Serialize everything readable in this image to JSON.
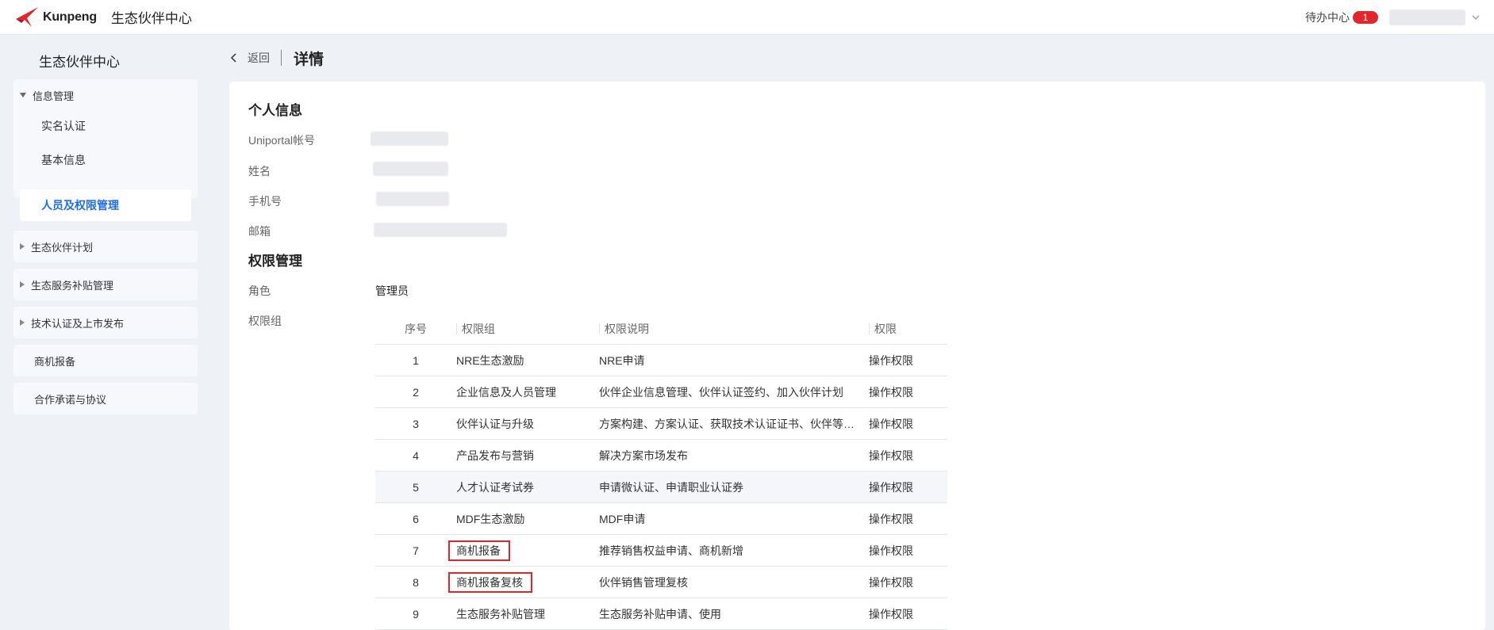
{
  "header": {
    "logo_text": "Kunpeng",
    "app_title": "生态伙伴中心",
    "todo_label": "待办中心",
    "todo_count": "1",
    "brand_red": "#e3262b"
  },
  "sidebar": {
    "title": "生态伙伴中心",
    "groups": [
      {
        "label": "信息管理",
        "expanded": true,
        "items": [
          {
            "label": "实名认证"
          },
          {
            "label": "基本信息"
          },
          {
            "label": "人员及权限管理",
            "active": true
          }
        ]
      },
      {
        "label": "生态伙伴计划",
        "expanded": false
      },
      {
        "label": "生态服务补贴管理",
        "expanded": false
      },
      {
        "label": "技术认证及上市发布",
        "expanded": false
      },
      {
        "label": "商机报备"
      },
      {
        "label": "合作承诺与协议"
      }
    ],
    "active_color": "#1f6de8"
  },
  "page": {
    "back_label": "返回",
    "title": "详情"
  },
  "personal": {
    "section_title": "个人信息",
    "fields": [
      {
        "label": "Uniportal帐号"
      },
      {
        "label": "姓名"
      },
      {
        "label": "手机号"
      },
      {
        "label": "邮箱"
      }
    ]
  },
  "permissions": {
    "section_title": "权限管理",
    "role_label": "角色",
    "role_value": "管理员",
    "group_label": "权限组",
    "table": {
      "headers": [
        "序号",
        "权限组",
        "权限说明",
        "权限"
      ],
      "rows": [
        {
          "no": "1",
          "group": "NRE生态激励",
          "desc": "NRE申请",
          "perm": "操作权限"
        },
        {
          "no": "2",
          "group": "企业信息及人员管理",
          "desc": "伙伴企业信息管理、伙伴认证签约、加入伙伴计划",
          "perm": "操作权限"
        },
        {
          "no": "3",
          "group": "伙伴认证与升级",
          "desc": "方案构建、方案认证、获取技术认证证书、伙伴等级升级",
          "perm": "操作权限"
        },
        {
          "no": "4",
          "group": "产品发布与营销",
          "desc": "解决方案市场发布",
          "perm": "操作权限"
        },
        {
          "no": "5",
          "group": "人才认证考试券",
          "desc": "申请微认证、申请职业认证券",
          "perm": "操作权限"
        },
        {
          "no": "6",
          "group": "MDF生态激励",
          "desc": "MDF申请",
          "perm": "操作权限"
        },
        {
          "no": "7",
          "group": "商机报备",
          "desc": "推荐销售权益申请、商机新增",
          "perm": "操作权限"
        },
        {
          "no": "8",
          "group": "商机报备复核",
          "desc": "伙伴销售管理复核",
          "perm": "操作权限"
        },
        {
          "no": "9",
          "group": "生态服务补贴管理",
          "desc": "生态服务补贴申请、使用",
          "perm": "操作权限"
        }
      ]
    }
  }
}
